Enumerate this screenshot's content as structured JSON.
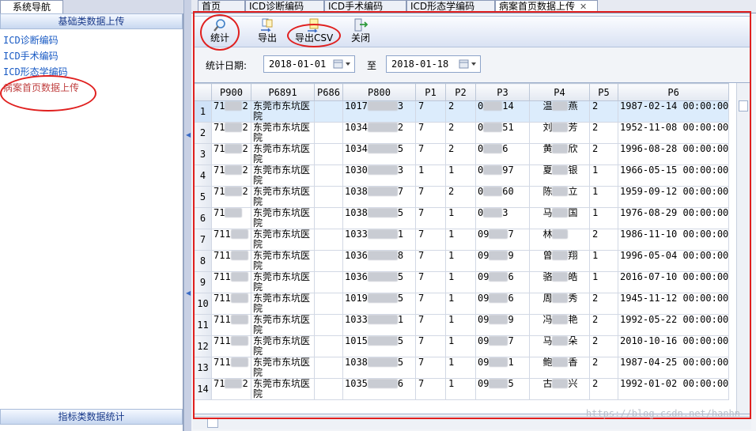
{
  "nav": {
    "tab_label": "系统导航",
    "section_top": "基础类数据上传",
    "items": [
      {
        "label": "ICD诊断编码"
      },
      {
        "label": "ICD手术编码"
      },
      {
        "label": "ICD形态学编码"
      },
      {
        "label": "病案首页数据上传"
      }
    ],
    "section_bottom": "指标类数据统计"
  },
  "tabs": [
    {
      "label": "首页"
    },
    {
      "label": "ICD诊断编码"
    },
    {
      "label": "ICD手术编码"
    },
    {
      "label": "ICD形态学编码"
    },
    {
      "label": "病案首页数据上传",
      "close": "✕"
    }
  ],
  "toolbar": {
    "stats_label": "统计",
    "export_label": "导出",
    "export_csv_label": "导出CSV",
    "close_label": "关闭"
  },
  "filter": {
    "date_label": "统计日期:",
    "date_from": "2018-01-01",
    "to_label": "至",
    "date_to": "2018-01-18"
  },
  "grid": {
    "columns": [
      "P900",
      "P6891",
      "P686",
      "P800",
      "P1",
      "P2",
      "P3",
      "P4",
      "P5",
      "P6"
    ],
    "rows": [
      {
        "n": "1",
        "p900_a": "71",
        "p900_b": "2",
        "hosp": "东莞市东坑医院",
        "p800_a": "1017",
        "p800_b": "3",
        "p1": "7",
        "p2": "2",
        "p3_a": "0",
        "p3_b": "14",
        "p4_a": "温",
        "p4_b": "燕",
        "p5": "2",
        "p6": "1987-02-14 00:00:00"
      },
      {
        "n": "2",
        "p900_a": "71",
        "p900_b": "2",
        "hosp": "东莞市东坑医院",
        "p800_a": "1034",
        "p800_b": "2",
        "p1": "7",
        "p2": "2",
        "p3_a": "0",
        "p3_b": "51",
        "p4_a": "刘",
        "p4_b": "芳",
        "p5": "2",
        "p6": "1952-11-08 00:00:00"
      },
      {
        "n": "3",
        "p900_a": "71",
        "p900_b": "2",
        "hosp": "东莞市东坑医院",
        "p800_a": "1034",
        "p800_b": "5",
        "p1": "7",
        "p2": "2",
        "p3_a": "0",
        "p3_b": "6",
        "p4_a": "黄",
        "p4_b": "欣",
        "p5": "2",
        "p6": "1996-08-28 00:00:00"
      },
      {
        "n": "4",
        "p900_a": "71",
        "p900_b": "2",
        "hosp": "东莞市东坑医院",
        "p800_a": "1030",
        "p800_b": "3",
        "p1": "1",
        "p2": "1",
        "p3_a": "0",
        "p3_b": "97",
        "p4_a": "夏",
        "p4_b": "银",
        "p5": "1",
        "p6": "1966-05-15 00:00:00"
      },
      {
        "n": "5",
        "p900_a": "71",
        "p900_b": "2",
        "hosp": "东莞市东坑医院",
        "p800_a": "1038",
        "p800_b": "7",
        "p1": "7",
        "p2": "2",
        "p3_a": "0",
        "p3_b": "60",
        "p4_a": "陈",
        "p4_b": "立",
        "p5": "1",
        "p6": "1959-09-12 00:00:00"
      },
      {
        "n": "6",
        "p900_a": "71",
        "p900_b": "",
        "hosp": "东莞市东坑医院",
        "p800_a": "1038",
        "p800_b": "5",
        "p1": "7",
        "p2": "1",
        "p3_a": "0",
        "p3_b": "3",
        "p4_a": "马",
        "p4_b": "国",
        "p5": "1",
        "p6": "1976-08-29 00:00:00"
      },
      {
        "n": "7",
        "p900_a": "711",
        "p900_b": "",
        "hosp": "东莞市东坑医院",
        "p800_a": "1033",
        "p800_b": "1",
        "p1": "7",
        "p2": "1",
        "p3_a": "09",
        "p3_b": "7",
        "p4_a": "林",
        "p4_b": "",
        "p5": "2",
        "p6": "1986-11-10 00:00:00"
      },
      {
        "n": "8",
        "p900_a": "711",
        "p900_b": "",
        "hosp": "东莞市东坑医院",
        "p800_a": "1036",
        "p800_b": "8",
        "p1": "7",
        "p2": "1",
        "p3_a": "09",
        "p3_b": "9",
        "p4_a": "曾",
        "p4_b": "翔",
        "p5": "1",
        "p6": "1996-05-04 00:00:00"
      },
      {
        "n": "9",
        "p900_a": "711",
        "p900_b": "",
        "hosp": "东莞市东坑医院",
        "p800_a": "1036",
        "p800_b": "5",
        "p1": "7",
        "p2": "1",
        "p3_a": "09",
        "p3_b": "6",
        "p4_a": "骆",
        "p4_b": "皓",
        "p5": "1",
        "p6": "2016-07-10 00:00:00"
      },
      {
        "n": "10",
        "p900_a": "711",
        "p900_b": "",
        "hosp": "东莞市东坑医院",
        "p800_a": "1019",
        "p800_b": "5",
        "p1": "7",
        "p2": "1",
        "p3_a": "09",
        "p3_b": "6",
        "p4_a": "周",
        "p4_b": "秀",
        "p5": "2",
        "p6": "1945-11-12 00:00:00"
      },
      {
        "n": "11",
        "p900_a": "711",
        "p900_b": "",
        "hosp": "东莞市东坑医院",
        "p800_a": "1033",
        "p800_b": "1",
        "p1": "7",
        "p2": "1",
        "p3_a": "09",
        "p3_b": "9",
        "p4_a": "冯",
        "p4_b": "艳",
        "p5": "2",
        "p6": "1992-05-22 00:00:00"
      },
      {
        "n": "12",
        "p900_a": "711",
        "p900_b": "",
        "hosp": "东莞市东坑医院",
        "p800_a": "1015",
        "p800_b": "5",
        "p1": "7",
        "p2": "1",
        "p3_a": "09",
        "p3_b": "7",
        "p4_a": "马",
        "p4_b": "朵",
        "p5": "2",
        "p6": "2010-10-16 00:00:00"
      },
      {
        "n": "13",
        "p900_a": "711",
        "p900_b": "",
        "hosp": "东莞市东坑医院",
        "p800_a": "1038",
        "p800_b": "5",
        "p1": "7",
        "p2": "1",
        "p3_a": "09",
        "p3_b": "1",
        "p4_a": "鲍",
        "p4_b": "香",
        "p5": "2",
        "p6": "1987-04-25 00:00:00"
      },
      {
        "n": "14",
        "p900_a": "71",
        "p900_b": "2",
        "hosp": "东莞市东坑医院",
        "p800_a": "1035",
        "p800_b": "6",
        "p1": "7",
        "p2": "1",
        "p3_a": "09",
        "p3_b": "5",
        "p4_a": "古",
        "p4_b": "兴",
        "p5": "2",
        "p6": "1992-01-02 00:00:00"
      }
    ]
  },
  "watermark": "https://blog.csdn.net/hanhn"
}
